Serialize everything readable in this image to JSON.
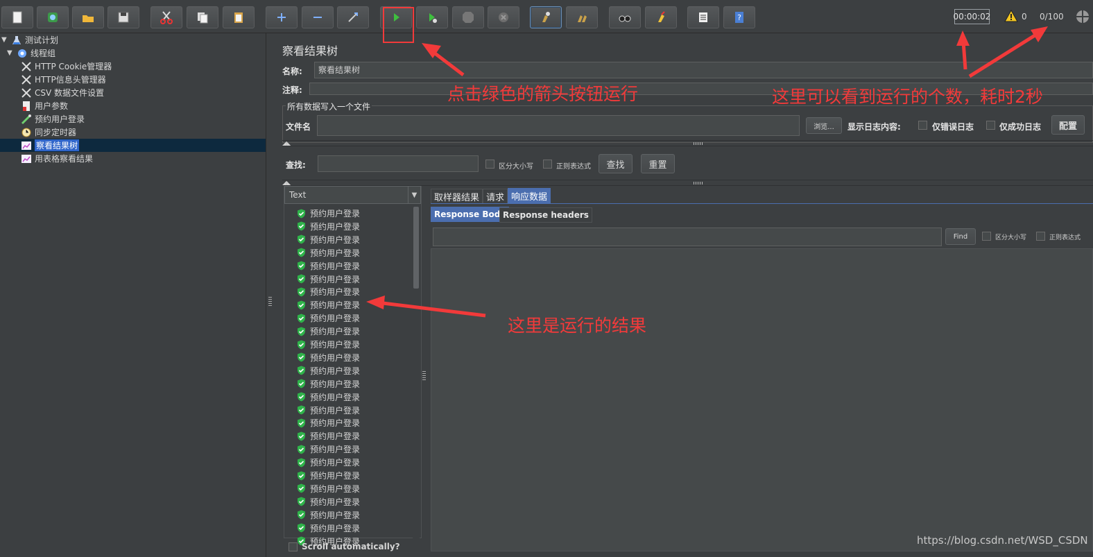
{
  "toolbar": {
    "timer": "00:00:02",
    "warnings": "0",
    "threads": "0/100"
  },
  "tree": {
    "items": [
      {
        "label": "测试计划",
        "icon": "flask-icon"
      },
      {
        "label": "线程组",
        "icon": "gear-icon"
      },
      {
        "label": "HTTP Cookie管理器",
        "icon": "wrench-icon"
      },
      {
        "label": "HTTP信息头管理器",
        "icon": "wrench-icon"
      },
      {
        "label": "CSV 数据文件设置",
        "icon": "wrench-icon"
      },
      {
        "label": "用户参数",
        "icon": "document-icon"
      },
      {
        "label": "预约用户登录",
        "icon": "pipette-icon"
      },
      {
        "label": "同步定时器",
        "icon": "clock-icon"
      },
      {
        "label": "察看结果树",
        "icon": "chart-icon"
      },
      {
        "label": "用表格察看结果",
        "icon": "chart-icon"
      }
    ]
  },
  "panel": {
    "title": "察看结果树",
    "name_label": "名称:",
    "name_value": "察看结果树",
    "comment_label": "注释:",
    "group_title": "所有数据写入一个文件",
    "filename_label": "文件名",
    "browse_button": "浏览...",
    "log_label": "显示日志内容:",
    "errors_only": "仅错误日志",
    "success_only": "仅成功日志",
    "config_button": "配置",
    "search_label": "查找:",
    "case_sensitive": "区分大小写",
    "regex": "正则表达式",
    "find_button": "查找",
    "reset_button": "重置"
  },
  "results": {
    "renderer": "Text",
    "item_label": "预约用户登录",
    "scroll_auto": "Scroll automatically?"
  },
  "tabs": {
    "sampler": "取样器结果",
    "request": "请求",
    "response": "响应数据",
    "body": "Response Body",
    "headers": "Response headers",
    "find": "Find",
    "case_sensitive": "区分大小写",
    "regex": "正则表达式"
  },
  "annotations": {
    "run": "点击绿色的箭头按钮运行",
    "count": "这里可以看到运行的个数，耗时2秒",
    "results": "这里是运行的结果"
  },
  "watermark": "https://blog.csdn.net/WSD_CSDN",
  "colors": {
    "annotation": "#f23a3a",
    "accent": "#4b6eaf",
    "success": "#3fbf3f"
  }
}
